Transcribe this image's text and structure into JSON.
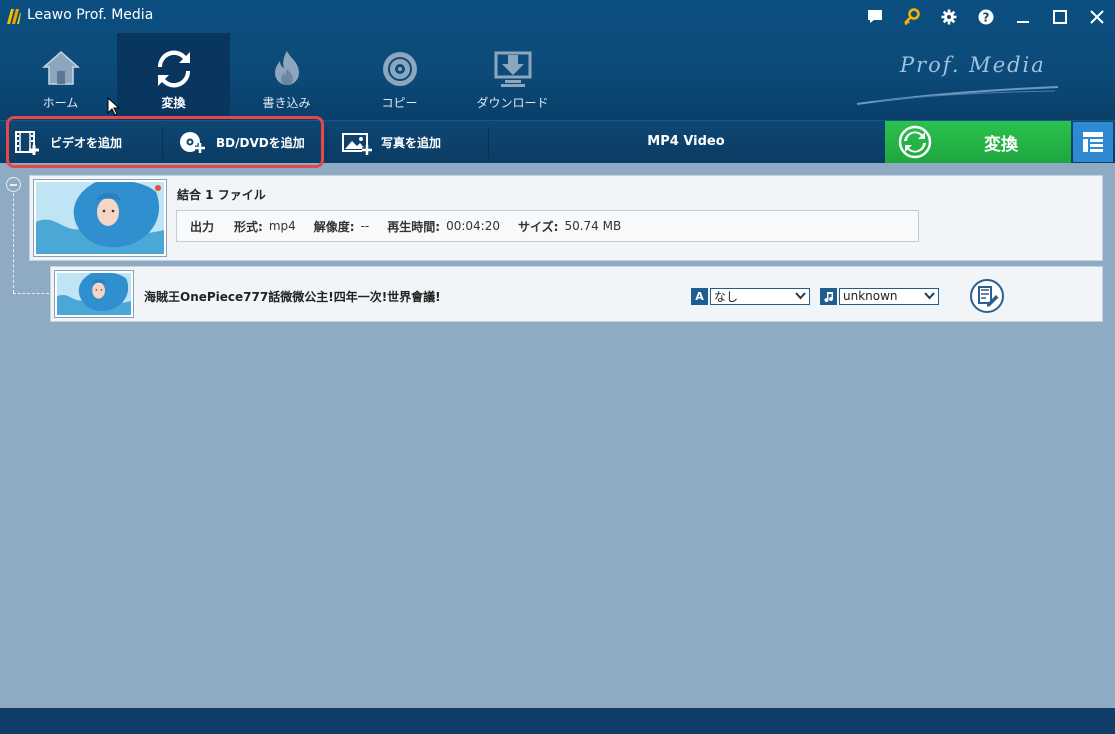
{
  "app": {
    "title": "Leawo Prof. Media",
    "brand": "Prof. Media"
  },
  "window_controls": [
    {
      "name": "feedback-icon"
    },
    {
      "name": "key-icon"
    },
    {
      "name": "gear-icon"
    },
    {
      "name": "help-icon"
    },
    {
      "name": "minimize-icon"
    },
    {
      "name": "maximize-icon"
    },
    {
      "name": "close-icon"
    }
  ],
  "nav": [
    {
      "label": "ホーム",
      "icon": "home-icon",
      "active": false
    },
    {
      "label": "変換",
      "icon": "convert-icon",
      "active": true
    },
    {
      "label": "書き込み",
      "icon": "burn-icon",
      "active": false
    },
    {
      "label": "コピー",
      "icon": "disc-copy-icon",
      "active": false
    },
    {
      "label": "ダウンロード",
      "icon": "download-icon",
      "active": false
    }
  ],
  "toolbar": {
    "add_video": "ビデオを追加",
    "add_bd_dvd": "BD/DVDを追加",
    "add_photo": "写真を追加",
    "output_format": "MP4 Video",
    "convert": "変換"
  },
  "group": {
    "title": "結合 1 ファイル",
    "info": {
      "output_label": "出力",
      "format_label": "形式:",
      "format_value": "mp4",
      "resolution_label": "解像度:",
      "resolution_value": "--",
      "duration_label": "再生時間:",
      "duration_value": "00:04:20",
      "size_label": "サイズ:",
      "size_value": "50.74 MB"
    }
  },
  "file": {
    "title": "海賊王OnePiece777話微微公主!四年一次!世界會議!",
    "subtitle_select": "なし",
    "audio_select": "unknown"
  },
  "colors": {
    "header_bg": "#0c4a79",
    "active_nav": "#08365e",
    "convert_green": "#22b045",
    "highlight_red": "#e8474a",
    "workspace_bg": "#8fabc4"
  }
}
